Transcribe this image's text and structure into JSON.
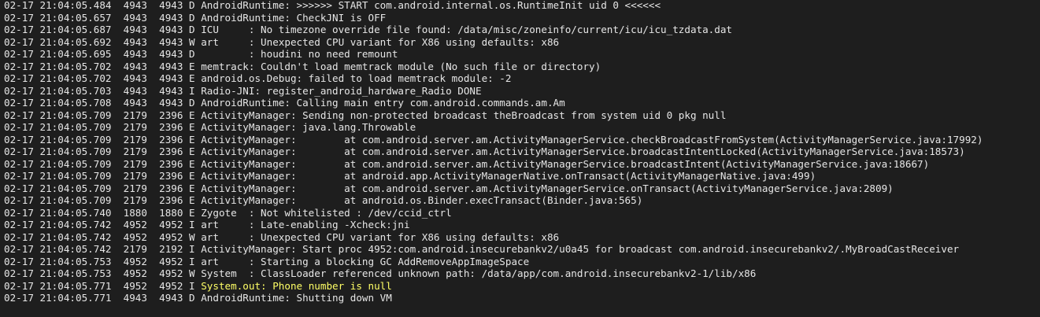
{
  "terminal": {
    "highlight_color": "#ffff66",
    "background_color": "#1e1e1e",
    "text_color": "#e6e6e6",
    "lines": [
      {
        "prefix": "02-17 21:04:05.484  4943  4943 D AndroidRuntime: >>>>>> START com.android.internal.os.RuntimeInit uid 0 <<<<<<",
        "highlight": ""
      },
      {
        "prefix": "02-17 21:04:05.657  4943  4943 D AndroidRuntime: CheckJNI is OFF",
        "highlight": ""
      },
      {
        "prefix": "02-17 21:04:05.687  4943  4943 D ICU     : No timezone override file found: /data/misc/zoneinfo/current/icu/icu_tzdata.dat",
        "highlight": ""
      },
      {
        "prefix": "02-17 21:04:05.692  4943  4943 W art     : Unexpected CPU variant for X86 using defaults: x86",
        "highlight": ""
      },
      {
        "prefix": "02-17 21:04:05.695  4943  4943 D         : houdini no need remount",
        "highlight": ""
      },
      {
        "prefix": "02-17 21:04:05.702  4943  4943 E memtrack: Couldn't load memtrack module (No such file or directory)",
        "highlight": ""
      },
      {
        "prefix": "02-17 21:04:05.702  4943  4943 E android.os.Debug: failed to load memtrack module: -2",
        "highlight": ""
      },
      {
        "prefix": "02-17 21:04:05.703  4943  4943 I Radio-JNI: register_android_hardware_Radio DONE",
        "highlight": ""
      },
      {
        "prefix": "02-17 21:04:05.708  4943  4943 D AndroidRuntime: Calling main entry com.android.commands.am.Am",
        "highlight": ""
      },
      {
        "prefix": "02-17 21:04:05.709  2179  2396 E ActivityManager: Sending non-protected broadcast theBroadcast from system uid 0 pkg null",
        "highlight": ""
      },
      {
        "prefix": "02-17 21:04:05.709  2179  2396 E ActivityManager: java.lang.Throwable",
        "highlight": ""
      },
      {
        "prefix": "02-17 21:04:05.709  2179  2396 E ActivityManager:        at com.android.server.am.ActivityManagerService.checkBroadcastFromSystem(ActivityManagerService.java:17992)",
        "highlight": ""
      },
      {
        "prefix": "02-17 21:04:05.709  2179  2396 E ActivityManager:        at com.android.server.am.ActivityManagerService.broadcastIntentLocked(ActivityManagerService.java:18573)",
        "highlight": ""
      },
      {
        "prefix": "02-17 21:04:05.709  2179  2396 E ActivityManager:        at com.android.server.am.ActivityManagerService.broadcastIntent(ActivityManagerService.java:18667)",
        "highlight": ""
      },
      {
        "prefix": "02-17 21:04:05.709  2179  2396 E ActivityManager:        at android.app.ActivityManagerNative.onTransact(ActivityManagerNative.java:499)",
        "highlight": ""
      },
      {
        "prefix": "02-17 21:04:05.709  2179  2396 E ActivityManager:        at com.android.server.am.ActivityManagerService.onTransact(ActivityManagerService.java:2809)",
        "highlight": ""
      },
      {
        "prefix": "02-17 21:04:05.709  2179  2396 E ActivityManager:        at android.os.Binder.execTransact(Binder.java:565)",
        "highlight": ""
      },
      {
        "prefix": "02-17 21:04:05.740  1880  1880 E Zygote  : Not whitelisted : /dev/ccid_ctrl",
        "highlight": ""
      },
      {
        "prefix": "02-17 21:04:05.742  4952  4952 I art     : Late-enabling -Xcheck:jni",
        "highlight": ""
      },
      {
        "prefix": "02-17 21:04:05.742  4952  4952 W art     : Unexpected CPU variant for X86 using defaults: x86",
        "highlight": ""
      },
      {
        "prefix": "02-17 21:04:05.742  2179  2192 I ActivityManager: Start proc 4952:com.android.insecurebankv2/u0a45 for broadcast com.android.insecurebankv2/.MyBroadCastReceiver",
        "highlight": ""
      },
      {
        "prefix": "02-17 21:04:05.753  4952  4952 I art     : Starting a blocking GC AddRemoveAppImageSpace",
        "highlight": ""
      },
      {
        "prefix": "02-17 21:04:05.753  4952  4952 W System  : ClassLoader referenced unknown path: /data/app/com.android.insecurebankv2-1/lib/x86",
        "highlight": ""
      },
      {
        "prefix": "02-17 21:04:05.771  4952  4952 I ",
        "highlight": "System.out: Phone number is null"
      },
      {
        "prefix": "02-17 21:04:05.771  4943  4943 D AndroidRuntime: Shutting down VM",
        "highlight": ""
      }
    ]
  }
}
